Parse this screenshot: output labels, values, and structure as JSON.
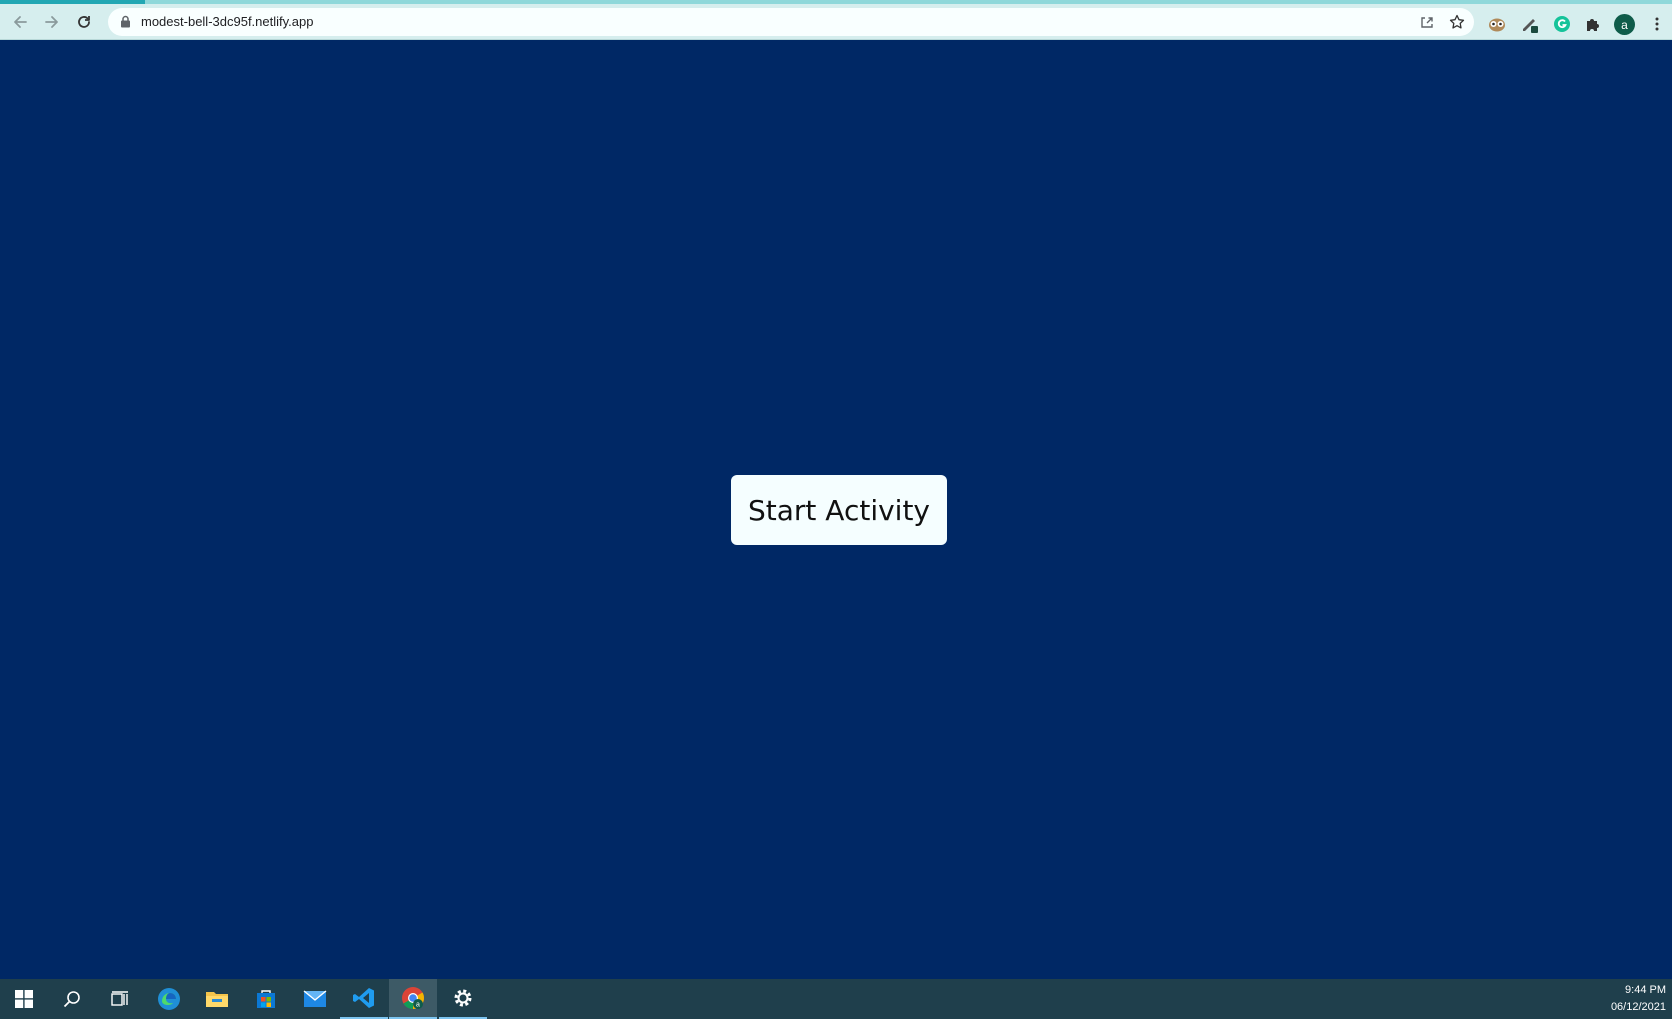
{
  "browser": {
    "url": "modest-bell-3dc95f.netlify.app",
    "profile_initial": "a",
    "nav": {
      "back_icon": "arrow-left-icon",
      "forward_icon": "arrow-right-icon",
      "reload_icon": "reload-icon"
    },
    "omnibox_actions": [
      "share-icon",
      "star-icon"
    ],
    "extensions": [
      "owl-extension-icon",
      "pen-extension-icon",
      "grammarly-icon",
      "puzzle-icon"
    ],
    "menu_icon": "kebab-menu-icon"
  },
  "page": {
    "background": "#002865",
    "start_button_label": "Start Activity"
  },
  "taskbar": {
    "apps": [
      {
        "name": "windows-start-icon"
      },
      {
        "name": "search-icon"
      },
      {
        "name": "task-view-icon"
      },
      {
        "name": "edge-icon"
      },
      {
        "name": "file-explorer-icon"
      },
      {
        "name": "store-icon"
      },
      {
        "name": "mail-icon"
      },
      {
        "name": "vscode-icon"
      },
      {
        "name": "chrome-icon"
      },
      {
        "name": "settings-icon"
      }
    ],
    "time": "9:44 PM",
    "date": "06/12/2021"
  }
}
